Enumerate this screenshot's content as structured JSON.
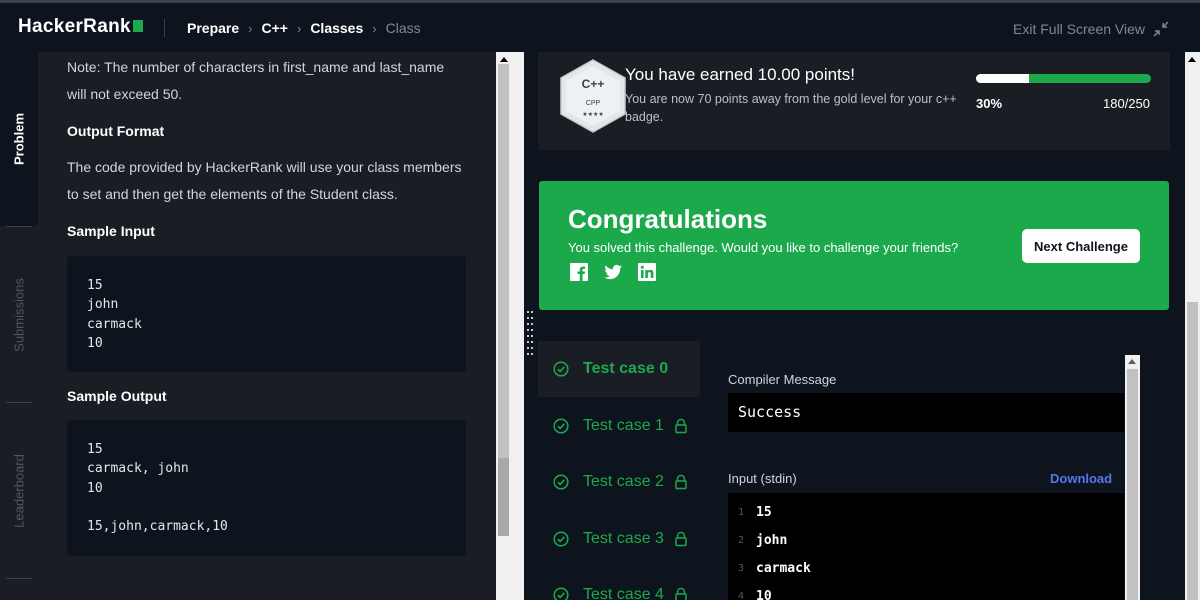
{
  "app": {
    "logo": "HackerRank",
    "breadcrumbs": [
      "Prepare",
      "C++",
      "Classes",
      "Class"
    ],
    "exit_label": "Exit Full Screen View"
  },
  "side_tabs": {
    "problem": "Problem",
    "submissions": "Submissions",
    "leaderboard": "Leaderboard"
  },
  "problem": {
    "note": "Note: The number of characters in first_name and last_name will not exceed 50.",
    "output_format_heading": "Output Format",
    "output_format_text": "The code provided by HackerRank will use your class members to set and then get the elements of the Student class.",
    "sample_input_heading": "Sample Input",
    "sample_input": "15\njohn\ncarmack\n10",
    "sample_output_heading": "Sample Output",
    "sample_output": "15\ncarmack, john\n10\n\n15,john,carmack,10"
  },
  "badge": {
    "hex_title": "C++",
    "hex_sub": "CPP",
    "hex_stars": "★★★★",
    "earned": "You have earned 10.00 points!",
    "subtext": "You are now 70 points away from the gold level for your c++ badge.",
    "progress_fraction": 0.3,
    "progress_pct": "30%",
    "progress_count": "180/250",
    "colors": {
      "fill": "#ffffff",
      "track": "#1ba94c"
    }
  },
  "congrats": {
    "title": "Congratulations",
    "subtitle": "You solved this challenge. Would you like to challenge your friends?",
    "share_icons": [
      "facebook-icon",
      "twitter-icon",
      "linkedin-icon"
    ],
    "next_button": "Next Challenge",
    "color": "#1ba94c"
  },
  "test_cases": [
    {
      "label": "Test case 0",
      "active": true,
      "locked": false
    },
    {
      "label": "Test case 1",
      "active": false,
      "locked": true
    },
    {
      "label": "Test case 2",
      "active": false,
      "locked": true
    },
    {
      "label": "Test case 3",
      "active": false,
      "locked": true
    },
    {
      "label": "Test case 4",
      "active": false,
      "locked": true
    }
  ],
  "output": {
    "compiler_label": "Compiler Message",
    "compiler_message": "Success",
    "input_label": "Input (stdin)",
    "download_label": "Download",
    "input_lines": [
      {
        "n": "1",
        "v": "15"
      },
      {
        "n": "2",
        "v": "john"
      },
      {
        "n": "3",
        "v": "carmack"
      },
      {
        "n": "4",
        "v": "10"
      }
    ]
  }
}
